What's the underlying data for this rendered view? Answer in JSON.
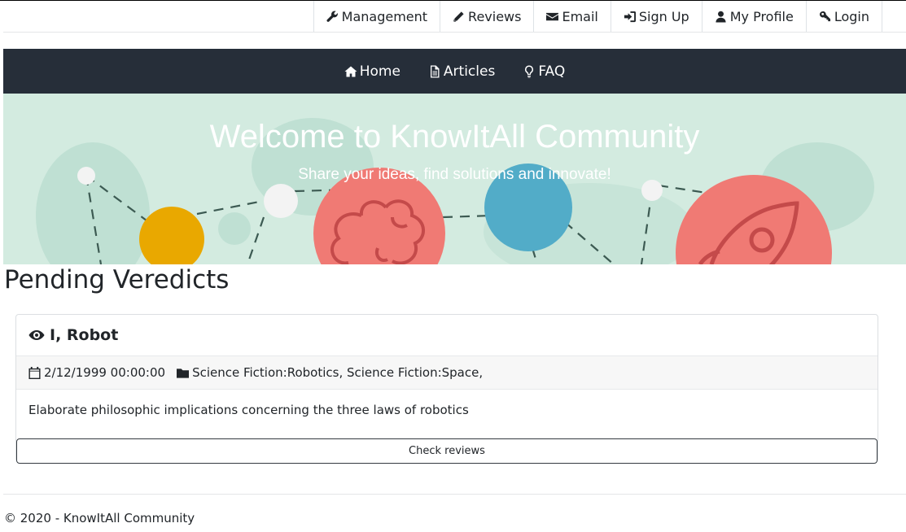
{
  "top_nav": {
    "items": [
      {
        "label": "Management",
        "icon": "wrench-icon"
      },
      {
        "label": "Reviews",
        "icon": "pencil-icon"
      },
      {
        "label": "Email",
        "icon": "envelope-icon"
      },
      {
        "label": "Sign Up",
        "icon": "sign-in-icon"
      },
      {
        "label": "My Profile",
        "icon": "user-icon"
      },
      {
        "label": "Login",
        "icon": "key-icon"
      }
    ]
  },
  "main_nav": {
    "items": [
      {
        "label": "Home",
        "icon": "home-icon"
      },
      {
        "label": "Articles",
        "icon": "file-icon"
      },
      {
        "label": "FAQ",
        "icon": "lightbulb-icon"
      }
    ]
  },
  "hero": {
    "title": "Welcome to KnowItAll Community",
    "subtitle": "Share your ideas, find solutions and innovate!"
  },
  "page": {
    "heading": "Pending Veredicts"
  },
  "article": {
    "title": "I, Robot",
    "date": "2/12/1999 00:00:00",
    "categories": "Science Fiction:Robotics, Science Fiction:Space,",
    "description": "Elaborate philosophic implications concerning the three laws of robotics",
    "button_label": "Check reviews"
  },
  "footer": {
    "text": "© 2020 - KnowItAll Community"
  },
  "colors": {
    "navbar": "#262e39",
    "hero_bg": "#d3ebe0",
    "coral": "#f07a74",
    "teal": "#52acc8",
    "yellow": "#e9a800"
  }
}
